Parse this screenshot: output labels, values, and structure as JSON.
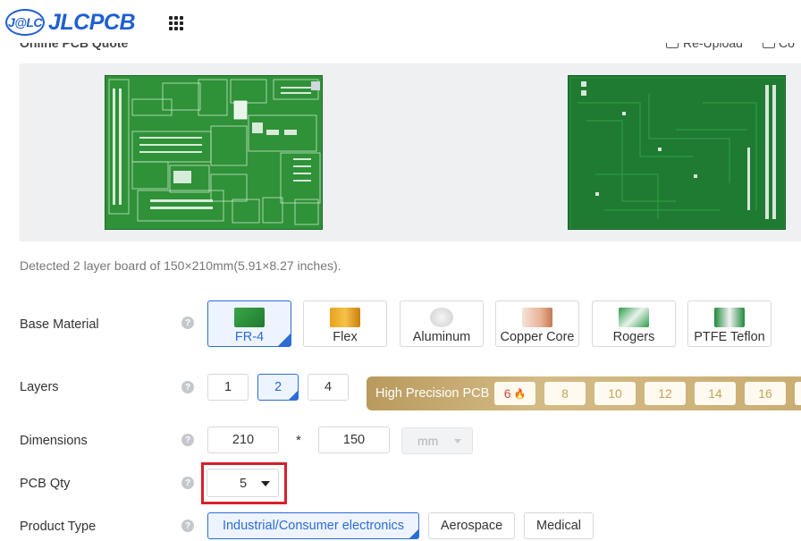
{
  "header": {
    "logo_mark": "J@LC",
    "logo_text": "JLCPCB"
  },
  "peek": {
    "title": "Online PCB Quote",
    "reupload": "Re-Upload",
    "other": "Co"
  },
  "detected_text": "Detected 2 layer board of 150×210mm(5.91×8.27 inches).",
  "base_material": {
    "label": "Base Material",
    "options": [
      "FR-4",
      "Flex",
      "Aluminum",
      "Copper Core",
      "Rogers",
      "PTFE Teflon"
    ],
    "selected": "FR-4"
  },
  "layers": {
    "label": "Layers",
    "options": [
      "1",
      "2",
      "4"
    ],
    "selected": "2",
    "high_precision_label": "High Precision PCB",
    "high_precision_options": [
      "6",
      "8",
      "10",
      "12",
      "14",
      "16"
    ]
  },
  "dimensions": {
    "label": "Dimensions",
    "width": "210",
    "separator": "*",
    "height": "150",
    "unit": "mm"
  },
  "pcb_qty": {
    "label": "PCB Qty",
    "value": "5"
  },
  "product_type": {
    "label": "Product Type",
    "options": [
      "Industrial/Consumer electronics",
      "Aerospace",
      "Medical"
    ],
    "selected": "Industrial/Consumer electronics"
  },
  "colors": {
    "brand_blue": "#1f5fd1",
    "selected_blue": "#2c6cd6",
    "highlight_red": "#d81e2a",
    "gold": "#c9ad73",
    "pcb_green": "#2e8f3a"
  },
  "icons": {
    "apps": "grid-icon",
    "help": "question-circle-icon",
    "upload": "upload-icon",
    "flame": "flame-icon",
    "dropdown": "caret-down-icon"
  }
}
